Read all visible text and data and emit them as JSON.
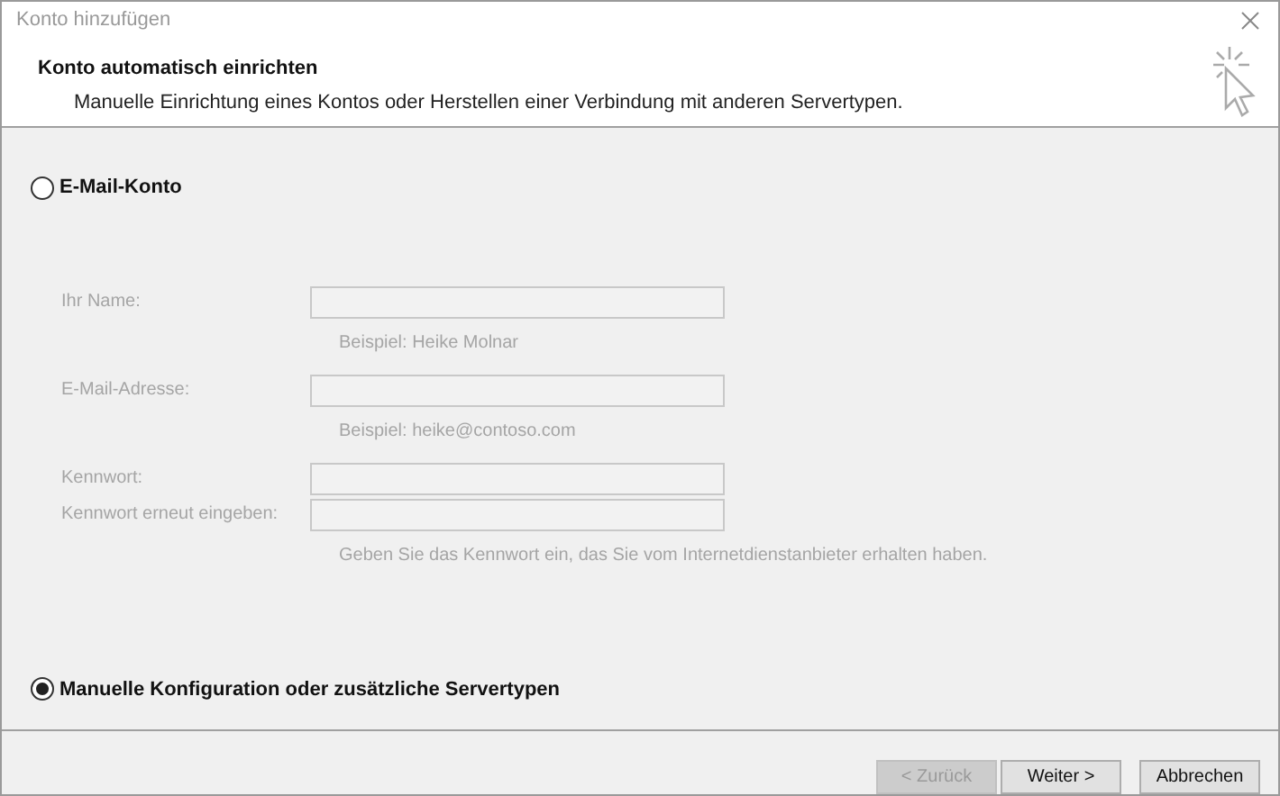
{
  "window": {
    "title": "Konto hinzufügen"
  },
  "header": {
    "title": "Konto automatisch einrichten",
    "subtitle": "Manuelle Einrichtung eines Kontos oder Herstellen einer Verbindung mit anderen Servertypen."
  },
  "options": [
    {
      "label": "E-Mail-Konto",
      "selected": false
    },
    {
      "label": "Manuelle Konfiguration oder zusätzliche Servertypen",
      "selected": true
    }
  ],
  "fields": [
    {
      "label": "Ihr Name:",
      "disabled": true,
      "hint": "Beispiel: Heike Molnar"
    },
    {
      "label": "E-Mail-Adresse:",
      "disabled": true,
      "hint": "Beispiel: heike@contoso.com"
    },
    {
      "label": "Kennwort:",
      "disabled": true
    },
    {
      "label": "Kennwort erneut eingeben:",
      "disabled": true,
      "hint": "Geben Sie das Kennwort ein, das Sie vom Internetdienstanbieter erhalten haben."
    }
  ],
  "buttons": [
    {
      "label": "< Zurück",
      "disabled": true
    },
    {
      "label": "Weiter >",
      "disabled": false
    },
    {
      "label": "Abbrechen",
      "disabled": false
    }
  ]
}
